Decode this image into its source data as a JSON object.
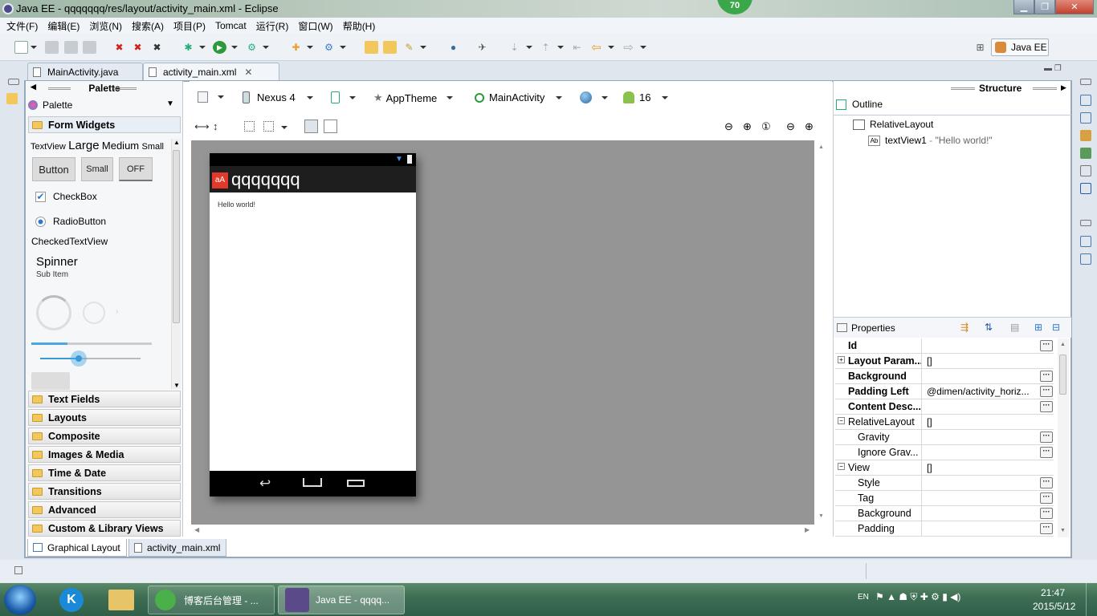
{
  "window": {
    "title": "Java EE - qqqqqqq/res/layout/activity_main.xml - Eclipse",
    "badge": "70"
  },
  "menu": [
    "文件(F)",
    "编辑(E)",
    "浏览(N)",
    "搜索(A)",
    "项目(P)",
    "Tomcat",
    "运行(R)",
    "窗口(W)",
    "帮助(H)"
  ],
  "perspective": "Java EE",
  "editor_tabs": [
    {
      "label": "MainActivity.java"
    },
    {
      "label": "activity_main.xml",
      "active": true
    }
  ],
  "palette": {
    "header": "Palette",
    "dropdown": "Palette",
    "open_drawer": "Form Widgets",
    "widgets": {
      "textview": "TextView",
      "large": "Large",
      "medium": "Medium",
      "small": "Small",
      "button": "Button",
      "small_button": "Small",
      "toggle": "OFF",
      "checkbox": "CheckBox",
      "radio": "RadioButton",
      "checked_text": "CheckedTextView",
      "spinner": "Spinner",
      "sub_item": "Sub Item"
    },
    "drawers": [
      "Text Fields",
      "Layouts",
      "Composite",
      "Images & Media",
      "Time & Date",
      "Transitions",
      "Advanced",
      "Custom & Library Views"
    ]
  },
  "designer": {
    "device": "Nexus 4",
    "theme": "AppTheme",
    "activity": "MainActivity",
    "api": "16",
    "app_title": "qqqqqqq",
    "hello": "Hello world!"
  },
  "structure": {
    "header": "Structure",
    "outline_label": "Outline",
    "tree": {
      "root": "RelativeLayout",
      "child": "textView1",
      "child_sep": " - ",
      "child_text": "\"Hello world!\""
    },
    "properties_label": "Properties",
    "properties": [
      {
        "name": "Id",
        "value": "",
        "bold": true,
        "dots": true
      },
      {
        "name": "Layout Param...",
        "value": "[]",
        "bold": true,
        "expand": true
      },
      {
        "name": "Background",
        "value": "",
        "bold": true,
        "dots": true
      },
      {
        "name": "Padding Left",
        "value": "@dimen/activity_horiz...",
        "bold": true,
        "dots": true
      },
      {
        "name": "Content Desc...",
        "value": "",
        "bold": true,
        "dots": true
      },
      {
        "name": "RelativeLayout",
        "value": "[]",
        "collapse": true
      },
      {
        "name": "Gravity",
        "value": "",
        "indent": true,
        "dots": true
      },
      {
        "name": "Ignore Grav...",
        "value": "",
        "indent": true,
        "dots": true
      },
      {
        "name": "View",
        "value": "[]",
        "collapse": true
      },
      {
        "name": "Style",
        "value": "",
        "indent": true,
        "dots": true
      },
      {
        "name": "Tag",
        "value": "",
        "indent": true,
        "dots": true
      },
      {
        "name": "Background",
        "value": "",
        "indent": true,
        "dots": true
      },
      {
        "name": "Padding",
        "value": "",
        "indent": true,
        "dots": true
      }
    ]
  },
  "bottom_tabs": [
    {
      "label": "Graphical Layout",
      "active": true
    },
    {
      "label": "activity_main.xml"
    }
  ],
  "taskbar": {
    "tasks": [
      {
        "label": "博客后台管理 - ..."
      },
      {
        "label": "Java EE - qqqq...",
        "active": true
      }
    ],
    "lang": "EN",
    "time": "21:47",
    "date": "2015/5/12"
  }
}
